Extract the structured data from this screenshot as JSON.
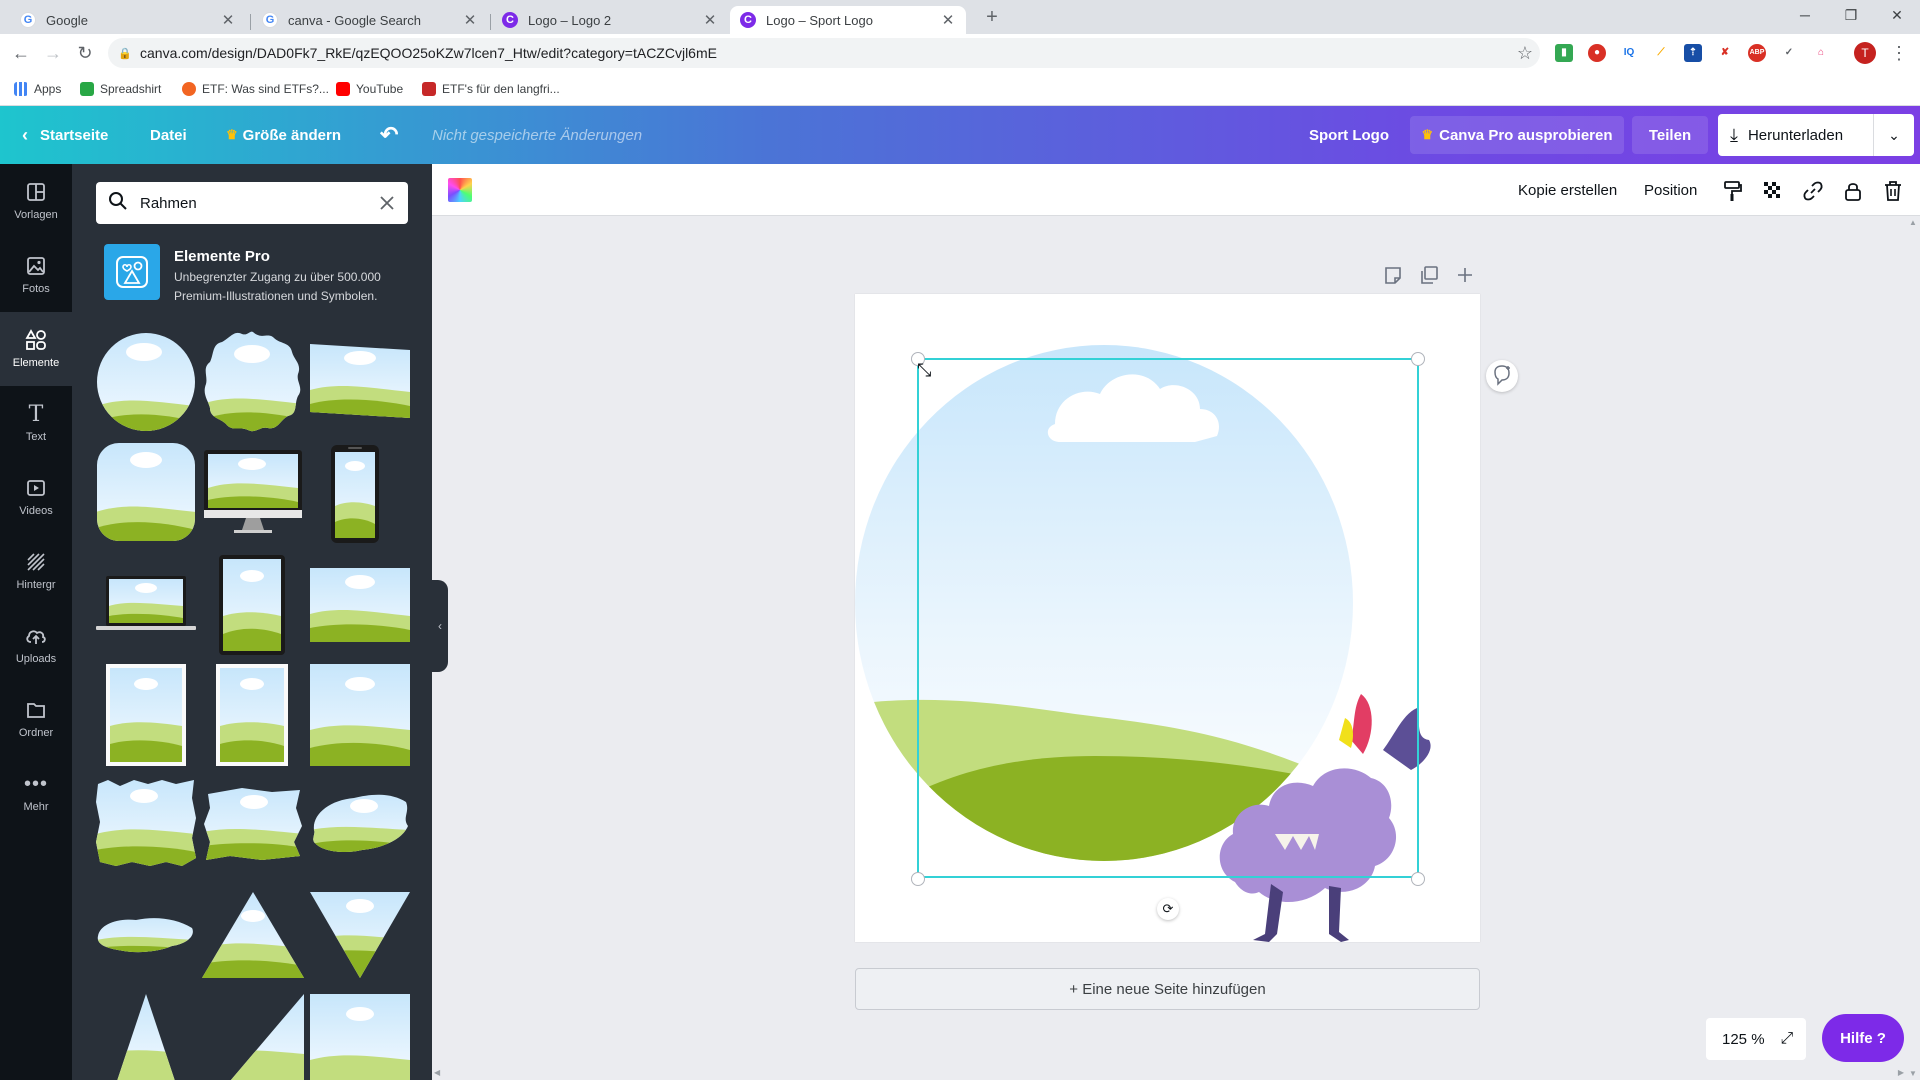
{
  "browser": {
    "tabs": [
      {
        "title": "Google",
        "icon": "google-icon"
      },
      {
        "title": "canva - Google Search",
        "icon": "google-icon"
      },
      {
        "title": "Logo – Logo 2",
        "icon": "canva-icon"
      },
      {
        "title": "Logo – Sport Logo",
        "icon": "canva-icon"
      }
    ],
    "url": "canva.com/design/DAD0Fk7_RkE/qzEQOO25oKZw7lcen7_Htw/edit?category=tACZCvjl6mE",
    "profile_initial": "T",
    "bookmarks": [
      {
        "label": "Apps",
        "color": "#4285f4"
      },
      {
        "label": "Spreadshirt",
        "color": "#28a745"
      },
      {
        "label": "ETF: Was sind ETFs?...",
        "color": "#f26522"
      },
      {
        "label": "YouTube",
        "color": "#ff0000"
      },
      {
        "label": "ETF's für den langfri...",
        "color": "#c62828"
      }
    ]
  },
  "header": {
    "home": "Startseite",
    "file": "Datei",
    "resize": "Größe ändern",
    "unsaved": "Nicht gespeicherte Änderungen",
    "title": "Sport Logo",
    "try_pro": "Canva Pro ausprobieren",
    "share": "Teilen",
    "download": "Herunterladen"
  },
  "rail": [
    {
      "label": "Vorlagen",
      "icon": "templates-icon"
    },
    {
      "label": "Fotos",
      "icon": "photos-icon"
    },
    {
      "label": "Elemente",
      "icon": "elements-icon",
      "active": true
    },
    {
      "label": "Text",
      "icon": "text-icon"
    },
    {
      "label": "Videos",
      "icon": "videos-icon"
    },
    {
      "label": "Hintergr",
      "icon": "background-icon"
    },
    {
      "label": "Uploads",
      "icon": "uploads-icon"
    },
    {
      "label": "Ordner",
      "icon": "folder-icon"
    },
    {
      "label": "Mehr",
      "icon": "more-icon"
    }
  ],
  "panel": {
    "search_value": "Rahmen",
    "promo_title": "Elemente Pro",
    "promo_desc": "Unbegrenzter Zugang zu über 500.000 Premium-Illustrationen und Symbolen."
  },
  "editor_toolbar": {
    "copy": "Kopie erstellen",
    "position": "Position"
  },
  "canvas": {
    "add_page": "+ Eine neue Seite hinzufügen",
    "zoom": "125 %",
    "help": "Hilfe ?"
  },
  "colors": {
    "sky_top": "#c7e6fb",
    "grass_light": "#c2dd7e",
    "grass_dark": "#8cb223",
    "selection": "#33d1d6",
    "canva_purple": "#7d2ae8",
    "monster_purple": "#a98fd6"
  }
}
